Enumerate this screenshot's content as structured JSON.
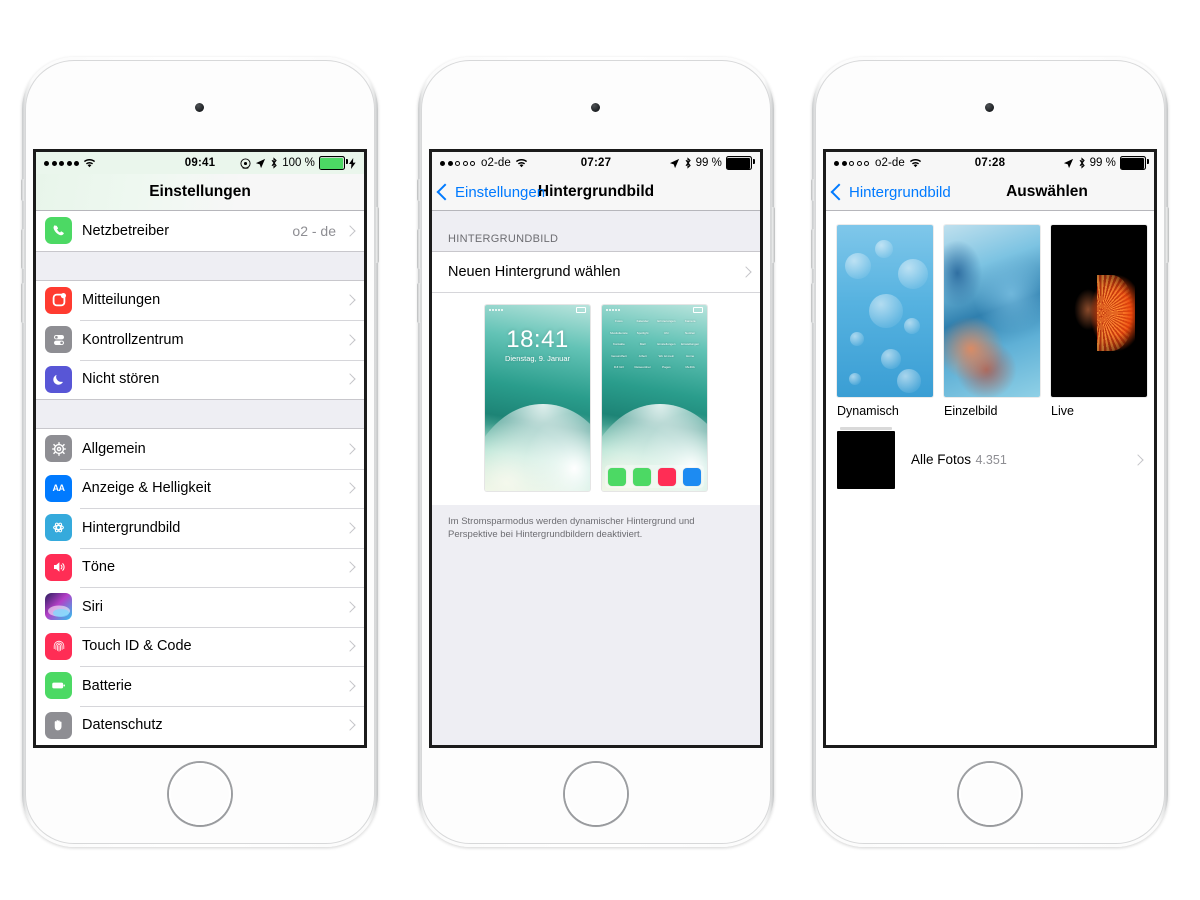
{
  "phones": [
    {
      "id": "phone-settings",
      "status": {
        "signal_dots": [
          true,
          true,
          true,
          true,
          true
        ],
        "carrier": "",
        "wifi_icon": "wifi-icon",
        "time": "09:41",
        "icons": [
          "alarm-icon",
          "location-icon",
          "bluetooth-icon"
        ],
        "battery_percent": "100 %",
        "battery_color": "#4cd964",
        "charging": true
      },
      "navbar": {
        "title": "Einstellungen",
        "back_label": "",
        "tinted": true
      },
      "groups": [
        {
          "rows": [
            {
              "icon": "phone-icon",
              "icon_color": "#4cd964",
              "label": "Netzbetreiber",
              "value": "o2 - de",
              "chevron": true
            }
          ]
        },
        {
          "rows": [
            {
              "icon": "notifications-icon",
              "icon_color": "#ff3b30",
              "label": "Mitteilungen",
              "value": "",
              "chevron": true
            },
            {
              "icon": "control-center-icon",
              "icon_color": "#8e8e93",
              "label": "Kontrollzentrum",
              "value": "",
              "chevron": true
            },
            {
              "icon": "moon-icon",
              "icon_color": "#5856d6",
              "label": "Nicht stören",
              "value": "",
              "chevron": true
            }
          ]
        },
        {
          "rows": [
            {
              "icon": "gear-icon",
              "icon_color": "#8e8e93",
              "label": "Allgemein",
              "value": "",
              "chevron": true
            },
            {
              "icon": "display-brightness-icon",
              "icon_color": "#007aff",
              "label": "Anzeige & Helligkeit",
              "value": "",
              "chevron": true
            },
            {
              "icon": "wallpaper-icon",
              "icon_color": "#35aadc",
              "label": "Hintergrundbild",
              "value": "",
              "chevron": true
            },
            {
              "icon": "sounds-icon",
              "icon_color": "#ff2d55",
              "label": "Töne",
              "value": "",
              "chevron": true
            },
            {
              "icon": "siri-icon",
              "icon_color": "#1c1c3a",
              "label": "Siri",
              "value": "",
              "chevron": true
            },
            {
              "icon": "touch-id-icon",
              "icon_color": "#ff2d55",
              "label": "Touch ID & Code",
              "value": "",
              "chevron": true
            },
            {
              "icon": "battery-icon",
              "icon_color": "#4cd964",
              "label": "Batterie",
              "value": "",
              "chevron": true
            },
            {
              "icon": "privacy-hand-icon",
              "icon_color": "#8e8e93",
              "label": "Datenschutz",
              "value": "",
              "chevron": true
            }
          ]
        }
      ]
    },
    {
      "id": "phone-wallpaper",
      "status": {
        "signal_dots": [
          true,
          true,
          false,
          false,
          false
        ],
        "carrier": "o2-de",
        "wifi_icon": "wifi-icon",
        "time": "07:27",
        "icons": [
          "location-icon",
          "bluetooth-icon"
        ],
        "battery_percent": "99 %",
        "battery_color": "#000000",
        "charging": false
      },
      "navbar": {
        "back_label": "Einstellungen",
        "title": "Hintergrundbild",
        "tinted": false
      },
      "section_header": "HINTERGRUNDBILD",
      "choose_row": {
        "label": "Neuen Hintergrund wählen",
        "chevron": true
      },
      "previews": {
        "lock": {
          "name": "lock-screen-preview",
          "time": "18:41",
          "date": "Dienstag, 9. Januar"
        },
        "home": {
          "name": "home-screen-preview",
          "apps": [
            {
              "label": "Fotos",
              "color": "#ffffff"
            },
            {
              "label": "Kalender",
              "color": "#ffffff"
            },
            {
              "label": "Erinnerungen",
              "color": "#ffffff"
            },
            {
              "label": "Kamera",
              "color": "#6d6d72"
            },
            {
              "label": "Musikdienste",
              "color": "#6a7a8a"
            },
            {
              "label": "Spotlight",
              "color": "#3f9ad6"
            },
            {
              "label": "Uhr",
              "color": "#f2f2f2"
            },
            {
              "label": "Notizen",
              "color": "#fcd862"
            },
            {
              "label": "Kontakte",
              "color": "#4a4a52"
            },
            {
              "label": "Mail",
              "color": "#3f9ad6"
            },
            {
              "label": "Einstellungen",
              "color": "#2e2e34"
            },
            {
              "label": "Einstellungen",
              "color": "#9aa0a6"
            },
            {
              "label": "Gesundheit",
              "color": "#2f3b33"
            },
            {
              "label": "Arbeit",
              "color": "#34343a"
            },
            {
              "label": "Wo ist mein",
              "color": "#f5a623"
            },
            {
              "label": "Home",
              "color": "#f2a33c"
            },
            {
              "label": "DJI GO",
              "color": "#1d6fd6"
            },
            {
              "label": "Reiseordner",
              "color": "#3a3a40"
            },
            {
              "label": "Pages",
              "color": "#3f9ad6"
            },
            {
              "label": "MeDIA",
              "color": "#ffffff"
            }
          ],
          "dock": [
            {
              "label": "Telefon",
              "color": "#4cd964"
            },
            {
              "label": "Nachrichten",
              "color": "#4cd964"
            },
            {
              "label": "Musik",
              "color": "#ff2d55"
            },
            {
              "label": "Safari",
              "color": "#1d8bf2"
            }
          ]
        }
      },
      "footnote": "Im Stromsparmodus werden dynamischer Hintergrund und Perspektive bei Hintergrundbildern deaktiviert."
    },
    {
      "id": "phone-choose",
      "status": {
        "signal_dots": [
          true,
          true,
          false,
          false,
          false
        ],
        "carrier": "o2-de",
        "wifi_icon": "wifi-icon",
        "time": "07:28",
        "icons": [
          "location-icon",
          "bluetooth-icon"
        ],
        "battery_percent": "99 %",
        "battery_color": "#000000",
        "charging": false
      },
      "navbar": {
        "back_label": "Hintergrundbild",
        "title": "Auswählen",
        "tinted": false
      },
      "categories": [
        {
          "label": "Dynamisch",
          "kind": "dynamic"
        },
        {
          "label": "Einzelbild",
          "kind": "still"
        },
        {
          "label": "Live",
          "kind": "live"
        }
      ],
      "album": {
        "name": "Alle Fotos",
        "count": "4.351",
        "chevron": true
      }
    }
  ],
  "colors": {
    "tint_blue": "#007aff",
    "group_bg": "#eeeef3",
    "separator": "#d6d6da",
    "secondary_text": "#8e8e93",
    "page_bg": "#ffffff"
  }
}
